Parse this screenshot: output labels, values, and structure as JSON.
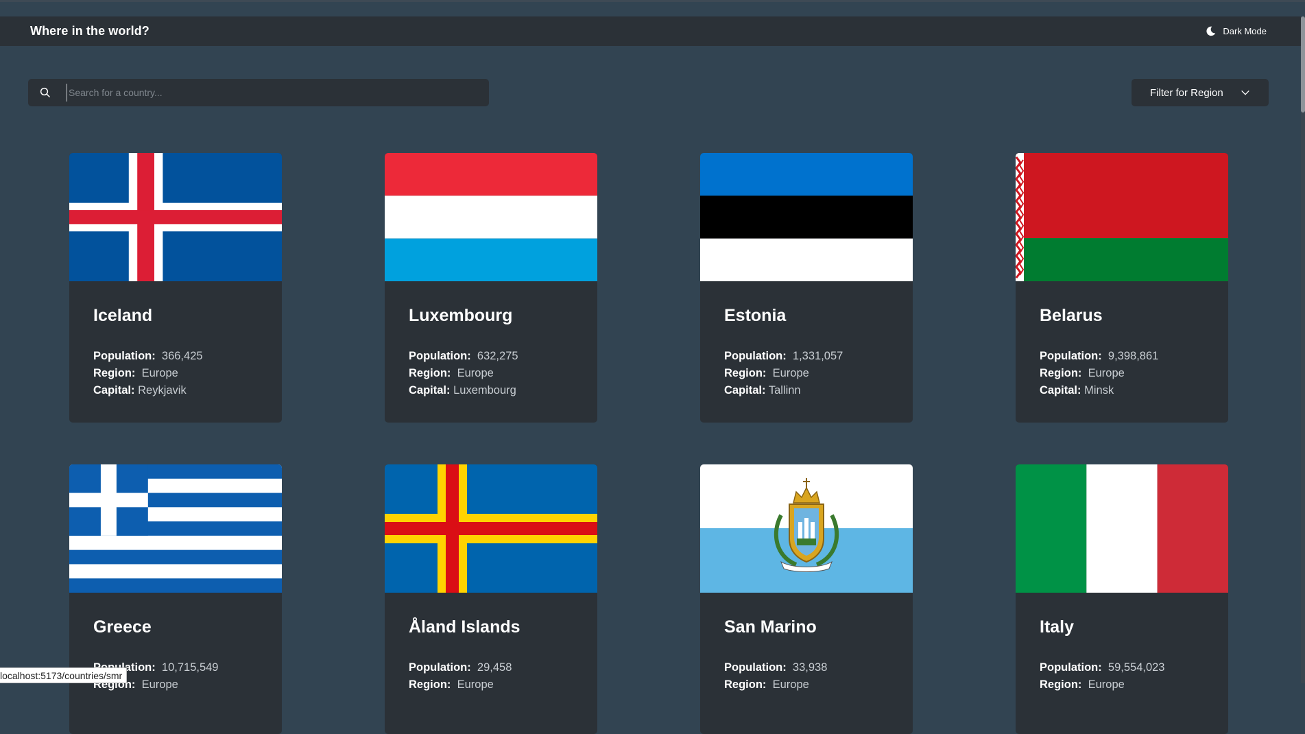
{
  "header": {
    "title": "Where in the world?",
    "mode_label": "Dark Mode"
  },
  "search": {
    "placeholder": "Search for a country..."
  },
  "filter": {
    "label": "Filter for Region"
  },
  "labels": {
    "population": "Population:",
    "region": "Region:",
    "capital": "Capital:"
  },
  "countries": [
    {
      "name": "Iceland",
      "population": "366,425",
      "region": "Europe",
      "capital": "Reykjavik"
    },
    {
      "name": "Luxembourg",
      "population": "632,275",
      "region": "Europe",
      "capital": "Luxembourg"
    },
    {
      "name": "Estonia",
      "population": "1,331,057",
      "region": "Europe",
      "capital": "Tallinn"
    },
    {
      "name": "Belarus",
      "population": "9,398,861",
      "region": "Europe",
      "capital": "Minsk"
    },
    {
      "name": "Greece",
      "population": "10,715,549",
      "region": "Europe",
      "capital": ""
    },
    {
      "name": "Åland Islands",
      "population": "29,458",
      "region": "Europe",
      "capital": ""
    },
    {
      "name": "San Marino",
      "population": "33,938",
      "region": "Europe",
      "capital": ""
    },
    {
      "name": "Italy",
      "population": "59,554,023",
      "region": "Europe",
      "capital": ""
    }
  ],
  "status_url": "localhost:5173/countries/smr",
  "colors": {
    "background": "#324452",
    "surface": "#2b3137",
    "text": "#ffffff",
    "muted_text": "#c9ced3"
  }
}
